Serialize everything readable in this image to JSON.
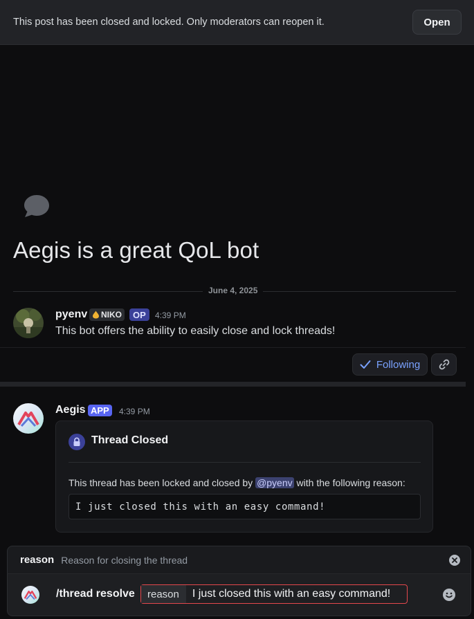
{
  "banner": {
    "text": "This post has been closed and locked. Only moderators can reopen it.",
    "open_label": "Open"
  },
  "thread": {
    "title": "Aegis is a great QoL bot",
    "date": "June 4, 2025"
  },
  "posts": [
    {
      "author": "pyenv",
      "tag": "NIKO",
      "badge": "OP",
      "time": "4:39 PM",
      "text": "This bot offers the ability to easily close and lock threads!"
    },
    {
      "author": "Aegis",
      "badge": "APP",
      "time": "4:39 PM",
      "embed": {
        "title": "Thread Closed",
        "desc_prefix": "This thread has been locked and closed by",
        "mention": "@pyenv",
        "desc_suffix": "with the following reason:",
        "code": "I just closed this with an easy command!"
      }
    }
  ],
  "post_actions": {
    "following_label": "Following"
  },
  "command_option": {
    "name": "reason",
    "description": "Reason for closing the thread"
  },
  "command_input": {
    "command": "/thread resolve",
    "field_label": "reason",
    "field_value": "I just closed this with an easy command!"
  },
  "colors": {
    "accent": "#5865f2",
    "link": "#7aa2ff",
    "error": "#e5484d"
  },
  "icons": {
    "thread": "speech-bubble-icon",
    "lock": "lock-icon",
    "check": "check-icon",
    "link": "link-icon",
    "close": "close-circle-icon",
    "emoji": "smiley-icon",
    "niko_tag": "drop-icon"
  }
}
